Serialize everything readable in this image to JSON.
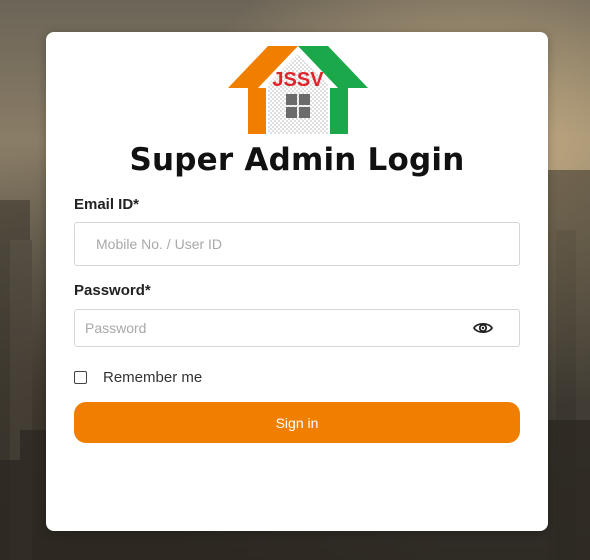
{
  "logo": {
    "text": "JSSV",
    "colors": {
      "left_roof": "#f07f00",
      "right_roof": "#1aa84a",
      "text": "#e0242b",
      "window": "#6b6b6b"
    }
  },
  "login": {
    "title": "Super Admin Login",
    "email_label": "Email ID*",
    "email_placeholder": "Mobile No. / User ID",
    "email_value": "",
    "password_label": "Password*",
    "password_placeholder": "Password",
    "password_value": "",
    "password_toggle_icon": "eye-icon",
    "remember_label": "Remember me",
    "remember_checked": false,
    "signin_label": "Sign in"
  },
  "theme": {
    "accent": "#f07f00",
    "card_background": "#ffffff"
  }
}
